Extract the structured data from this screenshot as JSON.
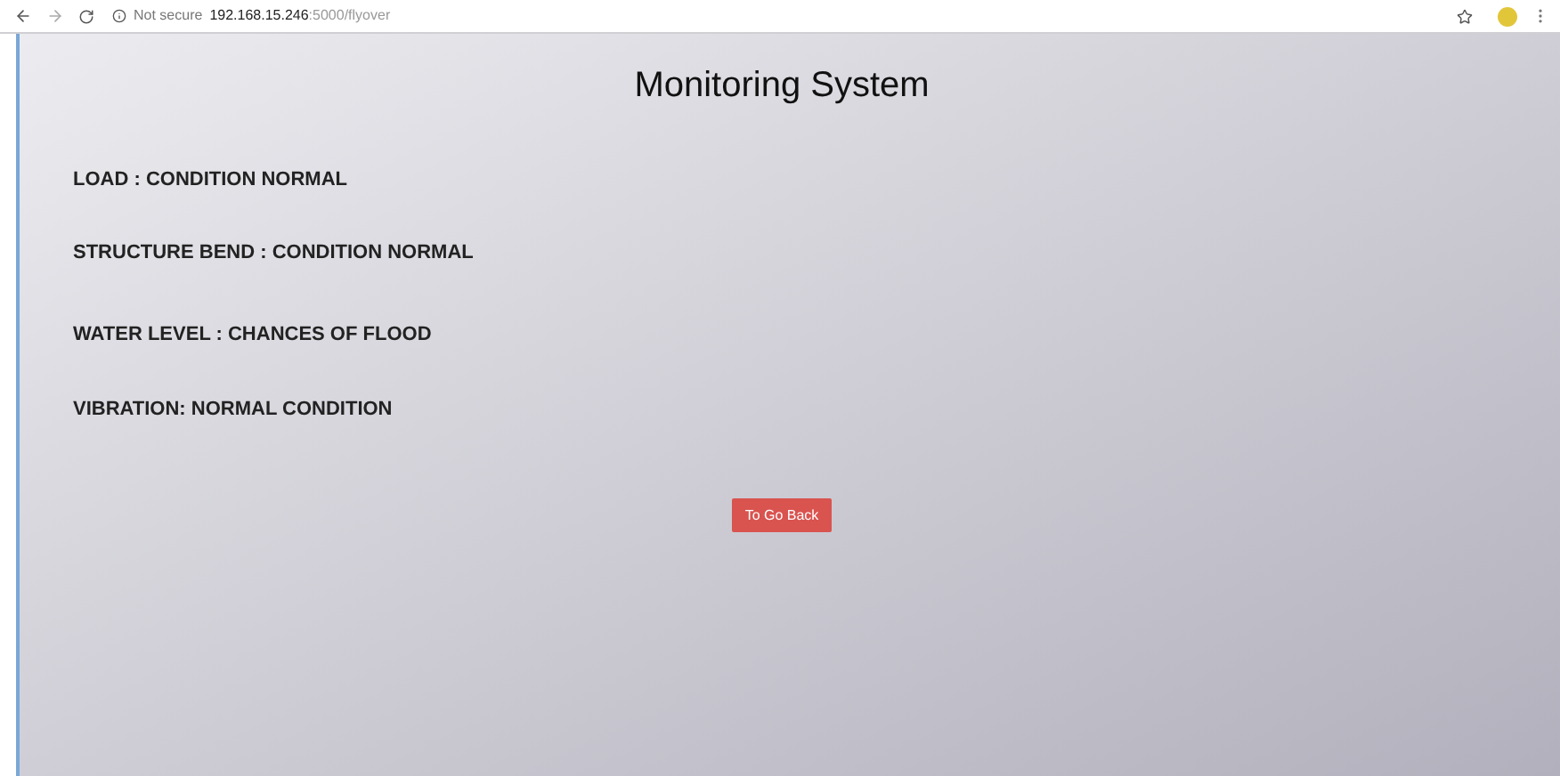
{
  "browser": {
    "security": "Not secure",
    "url_host": "192.168.15.246",
    "url_path": ":5000/flyover"
  },
  "title": "Monitoring System",
  "statuses": [
    "LOAD : CONDITION NORMAL",
    "STRUCTURE BEND : CONDITION NORMAL",
    "WATER LEVEL : CHANCES OF FLOOD",
    "VIBRATION: NORMAL CONDITION"
  ],
  "button": "To Go Back"
}
